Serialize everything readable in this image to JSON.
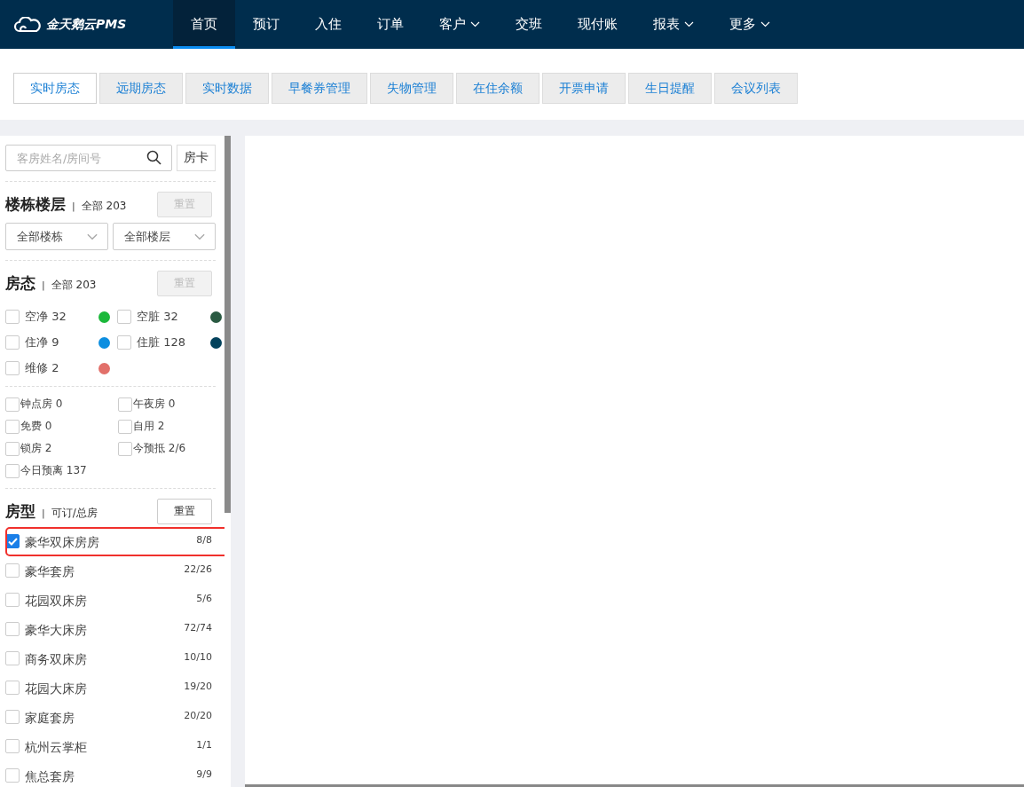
{
  "app": {
    "logo_text": "金天鹅云PMS"
  },
  "nav": [
    {
      "label": "首页",
      "selected": true,
      "has_menu": false
    },
    {
      "label": "预订",
      "selected": false,
      "has_menu": false
    },
    {
      "label": "入住",
      "selected": false,
      "has_menu": false
    },
    {
      "label": "订单",
      "selected": false,
      "has_menu": false
    },
    {
      "label": "客户",
      "selected": false,
      "has_menu": true
    },
    {
      "label": "交班",
      "selected": false,
      "has_menu": false
    },
    {
      "label": "现付账",
      "selected": false,
      "has_menu": false
    },
    {
      "label": "报表",
      "selected": false,
      "has_menu": true
    },
    {
      "label": "更多",
      "selected": false,
      "has_menu": true
    }
  ],
  "tabs": [
    {
      "label": "实时房态",
      "selected": true
    },
    {
      "label": "远期房态",
      "selected": false
    },
    {
      "label": "实时数据",
      "selected": false
    },
    {
      "label": "早餐券管理",
      "selected": false
    },
    {
      "label": "失物管理",
      "selected": false
    },
    {
      "label": "在住余额",
      "selected": false
    },
    {
      "label": "开票申请",
      "selected": false
    },
    {
      "label": "生日提醒",
      "selected": false
    },
    {
      "label": "会议列表",
      "selected": false
    }
  ],
  "sidebar": {
    "search": {
      "placeholder": "客房姓名/房间号"
    },
    "room_card_button": "房卡",
    "building": {
      "title": "楼栋楼层",
      "separator": "|",
      "summary": "全部 203",
      "reset": "重置",
      "reset_disabled": true,
      "building_select": "全部楼栋",
      "floor_select": "全部楼层"
    },
    "status": {
      "title": "房态",
      "separator": "|",
      "summary": "全部 203",
      "reset": "重置",
      "reset_disabled": true,
      "items": [
        {
          "label": "空净 32",
          "checked": false,
          "color": "#1bb83a"
        },
        {
          "label": "空脏 32",
          "checked": false,
          "color": "#2a5a42"
        },
        {
          "label": "住净 9",
          "checked": false,
          "color": "#0c8ee0"
        },
        {
          "label": "住脏 128",
          "checked": false,
          "color": "#03425c"
        },
        {
          "label": "维修 2",
          "checked": false,
          "color": "#e2706a"
        }
      ]
    },
    "flags": [
      {
        "label": "钟点房 0",
        "checked": false
      },
      {
        "label": "午夜房 0",
        "checked": false
      },
      {
        "label": "免费 0",
        "checked": false
      },
      {
        "label": "自用 2",
        "checked": false
      },
      {
        "label": "锁房 2",
        "checked": false
      },
      {
        "label": "今预抵 2/6",
        "checked": false
      },
      {
        "label": "今日预离 137",
        "checked": false
      }
    ],
    "room_types": {
      "title": "房型",
      "separator": "|",
      "summary": "可订/总房",
      "reset": "重置",
      "reset_disabled": false,
      "items": [
        {
          "name": "豪华双床房房",
          "count": "8/8",
          "checked": true,
          "highlighted": true
        },
        {
          "name": "豪华套房",
          "count": "22/26",
          "checked": false,
          "highlighted": false
        },
        {
          "name": "花园双床房",
          "count": "5/6",
          "checked": false,
          "highlighted": false
        },
        {
          "name": "豪华大床房",
          "count": "72/74",
          "checked": false,
          "highlighted": false
        },
        {
          "name": "商务双床房",
          "count": "10/10",
          "checked": false,
          "highlighted": false
        },
        {
          "name": "花园大床房",
          "count": "19/20",
          "checked": false,
          "highlighted": false
        },
        {
          "name": "家庭套房",
          "count": "20/20",
          "checked": false,
          "highlighted": false
        },
        {
          "name": "杭州云掌柜",
          "count": "1/1",
          "checked": false,
          "highlighted": false
        },
        {
          "name": "焦总套房",
          "count": "9/9",
          "checked": false,
          "highlighted": false
        }
      ]
    }
  }
}
